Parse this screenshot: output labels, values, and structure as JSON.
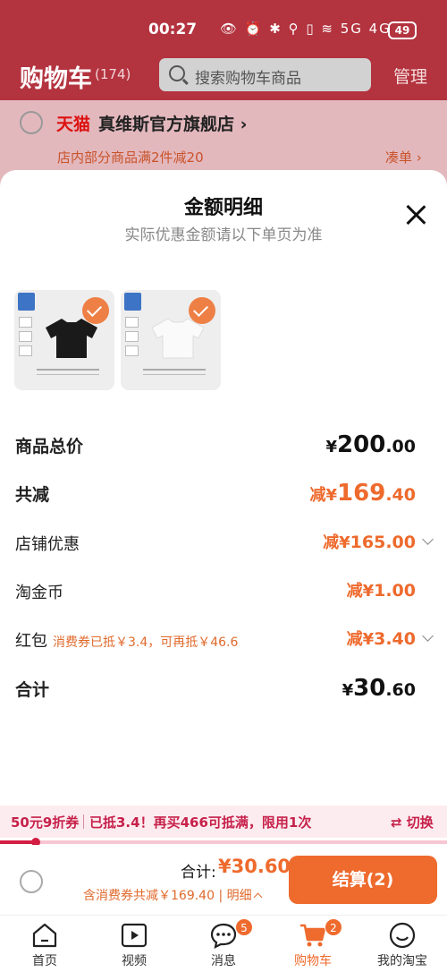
{
  "status": {
    "time": "00:27",
    "icons": "👁 ⏰ ✱ ⚲ ▯ ≋ 5G 4G",
    "battery": "49"
  },
  "header": {
    "title": "购物车",
    "count": "(174)",
    "search_placeholder": "搜索购物车商品",
    "manage": "管理"
  },
  "shop": {
    "brand": "天猫",
    "name": "真维斯官方旗舰店 ›",
    "promo": "店内部分商品满2件减20",
    "coudan": "凑单 ›"
  },
  "sheet": {
    "title": "金额明细",
    "subtitle": "实际优惠金额请以下单页为准",
    "rows": [
      {
        "label": "商品总价",
        "prefix": "",
        "currency": "¥",
        "int": "200",
        "dec": ".00",
        "note": ""
      },
      {
        "label": "共减",
        "prefix": "减",
        "currency": "¥",
        "int": "169",
        "dec": ".40",
        "note": ""
      },
      {
        "label": "店铺优惠",
        "prefix": "减",
        "currency": "¥",
        "int": "165",
        "dec": ".00",
        "note": ""
      },
      {
        "label": "淘金币",
        "prefix": "减",
        "currency": "¥",
        "int": "1",
        "dec": ".00",
        "note": ""
      },
      {
        "label": "红包",
        "prefix": "减",
        "currency": "¥",
        "int": "3",
        "dec": ".40",
        "note": "消费券已抵￥3.4，可再抵￥46.6"
      },
      {
        "label": "合计",
        "prefix": "",
        "currency": "¥",
        "int": "30",
        "dec": ".60",
        "note": ""
      }
    ]
  },
  "banner": {
    "tag": "50元9折券",
    "text": "已抵3.4！再买466可抵满，限用1次",
    "switch": "⇄ 切换",
    "progress": 0.08
  },
  "bottom": {
    "total_label": "合计:",
    "total_value": "¥30.60",
    "discount": "含消费券共减￥169.40",
    "detail": "明细",
    "checkout": "结算(2)"
  },
  "tabs": [
    {
      "label": "首页",
      "badge": ""
    },
    {
      "label": "视频",
      "badge": ""
    },
    {
      "label": "消息",
      "badge": "5"
    },
    {
      "label": "购物车",
      "badge": "2"
    },
    {
      "label": "我的淘宝",
      "badge": ""
    }
  ],
  "colors": {
    "accent": "#ee6a2d",
    "header": "#b3333f",
    "banner": "#c6214b"
  }
}
